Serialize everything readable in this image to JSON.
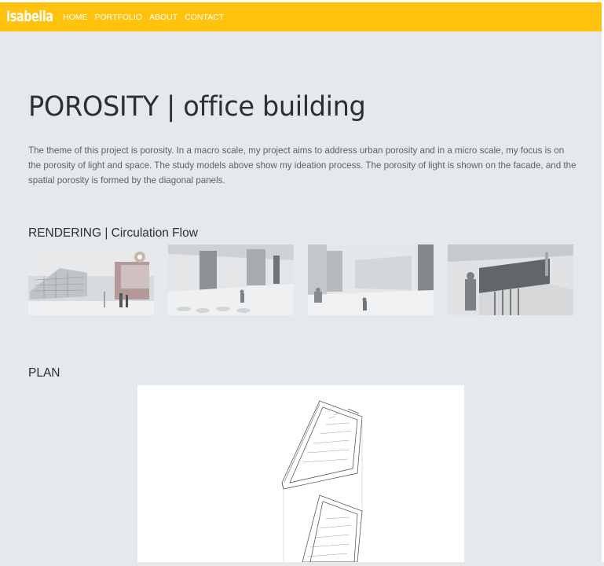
{
  "nav": {
    "logo": "Isabella",
    "links": [
      "HOME",
      "PORTFOLIO",
      "ABOUT",
      "CONTACT"
    ]
  },
  "project": {
    "title": "POROSITY | office building",
    "description": "The theme of this project is porosity. In a macro scale, my project aims to address urban porosity and in a micro scale, my focus is on the porosity of light and space. The study models above show my ideation process. The porosity of light is shown on the facade, and the spatial porosity is formed by the diagonal panels."
  },
  "sections": {
    "rendering_heading": "RENDERING | Circulation Flow",
    "plan_heading": "PLAN"
  },
  "colors": {
    "navbar": "#ffc20e",
    "background": "#e6e9ec",
    "text_dark": "#2c2f33",
    "text_body": "#5c6166"
  }
}
